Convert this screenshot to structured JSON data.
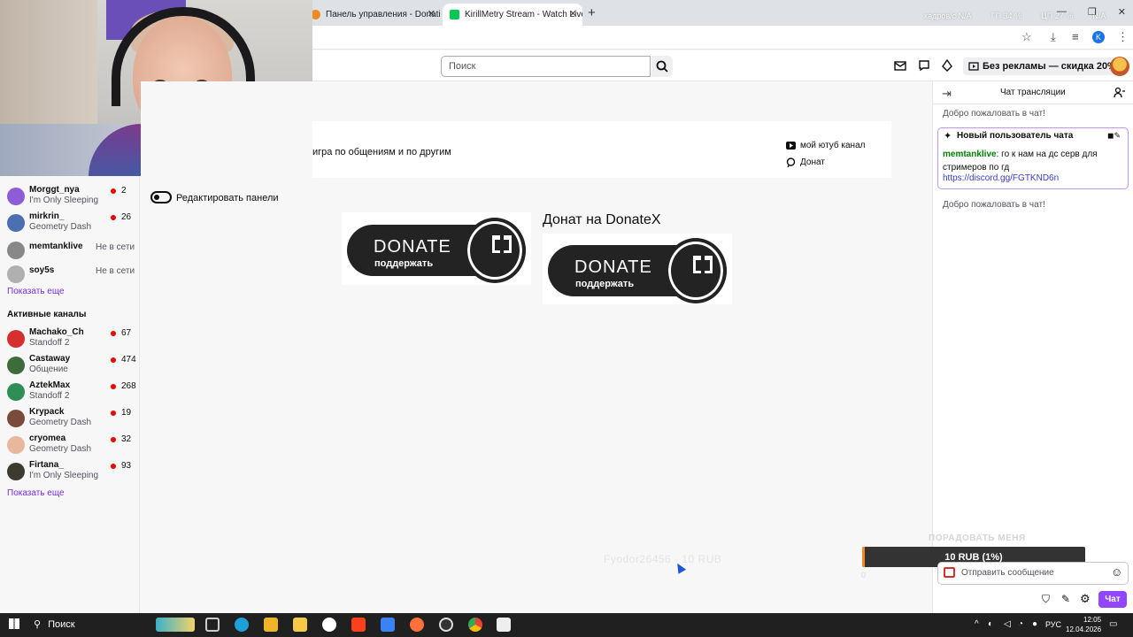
{
  "browser": {
    "tabs": [
      {
        "title": "Панель управления - Donation",
        "fav_color": "#f08a24"
      },
      {
        "title": "KirillMetry Stream - Watch Live",
        "fav_color": "#00c853"
      }
    ],
    "new_tab": "+",
    "stats": [
      "кадров/с N/A",
      "ГП 34 %",
      "ЦП 27 %",
      "N/A"
    ],
    "profile_letter": "K"
  },
  "topbar": {
    "search_placeholder": "Поиск",
    "promo": "Без рекламы — скидка 20%"
  },
  "sidebar": {
    "followed": [
      {
        "name": "Morggt_nya",
        "game": "I'm Only Sleeping",
        "viewers": "2",
        "live": true,
        "avatar": "#8e5cd9"
      },
      {
        "name": "mirkrin_",
        "game": "Geometry Dash",
        "viewers": "26",
        "live": true,
        "avatar": "#4b6fb0"
      },
      {
        "name": "memtanklive",
        "game": "",
        "status": "Не в сети",
        "live": false,
        "avatar": "#888888"
      },
      {
        "name": "soy5s",
        "game": "",
        "status": "Не в сети",
        "live": false,
        "avatar": "#b0b0b0"
      }
    ],
    "show_more_1": "Показать еще",
    "active_header": "Активные каналы",
    "active": [
      {
        "name": "Machako_Ch",
        "game": "Standoff 2",
        "viewers": "67",
        "avatar": "#d62f2f"
      },
      {
        "name": "Castaway",
        "game": "Общение",
        "viewers": "474",
        "avatar": "#3d6b3a"
      },
      {
        "name": "AztekMax",
        "game": "Standoff 2",
        "viewers": "268",
        "avatar": "#2f8d58"
      },
      {
        "name": "Krypack",
        "game": "Geometry Dash",
        "viewers": "19",
        "avatar": "#7a4b3a"
      },
      {
        "name": "cryomea",
        "game": "Geometry Dash",
        "viewers": "32",
        "avatar": "#e9b79d"
      },
      {
        "name": "Firtana_",
        "game": "I'm Only Sleeping",
        "viewers": "93",
        "avatar": "#3d3a2f"
      }
    ],
    "show_more_2": "Показать еще"
  },
  "main": {
    "about_text": "игра по общениям и по другим",
    "links": [
      {
        "label": "мой ютуб канал",
        "icon": "youtube-icon"
      },
      {
        "label": "Донат",
        "icon": "donate-icon"
      }
    ],
    "toggle_label": "Редактировать панели",
    "panel_title": "Донат на DonateX",
    "donate_big": "DONATE",
    "donate_small": "поддержать",
    "alert_ghost": "Fyodor26456 - 10 RUB"
  },
  "chat": {
    "title": "Чат трансляции",
    "welcome": "Добро пожаловать в чат!",
    "new_user_header": "Новый пользователь чата",
    "new_user_name": "memtanklive",
    "new_user_text": ": го к нам на дс серв для стримеров по гд",
    "new_user_link": "https://discord.gg/FGTKND6n",
    "welcome_2": "Добро пожаловать в чат!",
    "goal_title": "ПОРАДОВАТЬ МЕНЯ",
    "goal_text": "10 RUB (1%)",
    "goal_progress": 0.01,
    "goal_min": "0",
    "input_placeholder": "Отправить сообщение",
    "send_label": "Чат"
  },
  "taskbar": {
    "search_label": "Поиск",
    "lang": "РУС",
    "time": "12:05",
    "date": "12.04.2026"
  }
}
